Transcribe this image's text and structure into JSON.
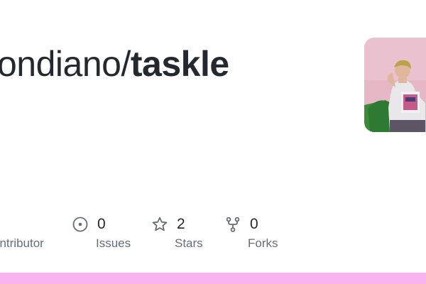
{
  "repo": {
    "owner_visible": "ondiano",
    "separator": "/",
    "name": "taskle"
  },
  "stats": {
    "contributors": {
      "label": "ontributor"
    },
    "issues": {
      "count": "0",
      "label": "Issues",
      "icon": "issue-opened-icon"
    },
    "stars": {
      "count": "2",
      "label": "Stars",
      "icon": "star-icon"
    },
    "forks": {
      "count": "0",
      "label": "Forks",
      "icon": "repo-forked-icon"
    }
  },
  "colors": {
    "accent_bar": "#f9b4ef",
    "text_primary": "#24292f",
    "text_muted": "#656d76"
  }
}
